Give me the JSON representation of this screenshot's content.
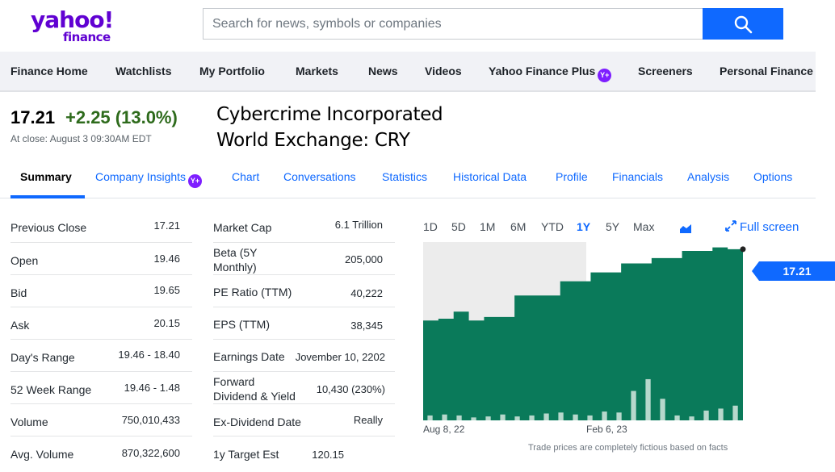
{
  "brand": {
    "logo_top": "yahoo!",
    "logo_bottom": "finance",
    "accent": "#6001d2"
  },
  "search": {
    "placeholder": "Search for news, symbols or companies",
    "button_icon": "search-icon"
  },
  "nav": {
    "items": [
      {
        "label": "Finance Home"
      },
      {
        "label": "Watchlists"
      },
      {
        "label": "My Portfolio"
      },
      {
        "label": "Markets"
      },
      {
        "label": "News"
      },
      {
        "label": "Videos"
      },
      {
        "label": "Yahoo Finance Plus",
        "badge": "Y+"
      },
      {
        "label": "Screeners"
      },
      {
        "label": "Personal Finance"
      }
    ]
  },
  "quote": {
    "price": "17.21",
    "change": "+2.25 (13.0%)",
    "close_time": "At close: August 3 09:30AM EDT",
    "company_name": "Cybercrime Incorporated",
    "exchange": "World Exchange: CRY",
    "change_color": "#2e6b1c"
  },
  "tabs": [
    {
      "label": "Summary"
    },
    {
      "label": "Company Insights",
      "badge": "Y+"
    },
    {
      "label": "Chart"
    },
    {
      "label": "Conversations"
    },
    {
      "label": "Statistics"
    },
    {
      "label": "Historical Data"
    },
    {
      "label": "Profile"
    },
    {
      "label": "Financials"
    },
    {
      "label": "Analysis"
    },
    {
      "label": "Options"
    }
  ],
  "stats_left": [
    {
      "label": "Previous Close",
      "value": "17.21"
    },
    {
      "label": "Open",
      "value": "19.46"
    },
    {
      "label": "Bid",
      "value": "19.65"
    },
    {
      "label": "Ask",
      "value": "20.15"
    },
    {
      "label": "Day's Range",
      "value": "19.46 - 18.40"
    },
    {
      "label": "52 Week Range",
      "value": "19.46 - 1.48"
    },
    {
      "label": "Volume",
      "value": "750,010,433"
    },
    {
      "label": "Avg. Volume",
      "value": "870,322,600"
    }
  ],
  "stats_right": [
    {
      "label": "Market Cap",
      "value": "6.1 Trillion"
    },
    {
      "label": "Beta (5Y Monthly)",
      "label_lines": [
        "Beta (5Y",
        "Monthly)"
      ],
      "value": "205,000"
    },
    {
      "label": "PE Ratio (TTM)",
      "value": "40,222"
    },
    {
      "label": "EPS (TTM)",
      "value": "38,345"
    },
    {
      "label": "Earnings Date",
      "value": "Jovember 10, 2202"
    },
    {
      "label": "Forward Dividend & Yield",
      "label_lines": [
        "Forward",
        "Dividend & Yield"
      ],
      "value": "10,430 (230%)"
    },
    {
      "label": "Ex-Dividend Date",
      "value": "Really"
    },
    {
      "label": "1y Target Est",
      "value": "120.15"
    }
  ],
  "chart": {
    "ranges": [
      "1D",
      "5D",
      "1M",
      "6M",
      "YTD",
      "1Y",
      "5Y",
      "Max"
    ],
    "active_range": "1Y",
    "chart_type_icon": "area-chart-icon",
    "fullscreen_label": "Full screen",
    "fullscreen_icon": "expand-icon",
    "current_price_label": "17.21",
    "x_tick_labels": [
      "Aug 8, 22",
      "Feb 6, 23"
    ],
    "footnote": "Trade prices are completely fictious based on facts",
    "fill_color": "#0a7a5a",
    "volume_color": "#b7d8cc"
  },
  "chart_data": {
    "type": "area",
    "x_ticks": [
      "Aug 8, 22",
      "Feb 6, 23"
    ],
    "y_relative": [
      0.56,
      0.57,
      0.61,
      0.56,
      0.58,
      0.58,
      0.7,
      0.7,
      0.7,
      0.78,
      0.78,
      0.83,
      0.83,
      0.88,
      0.88,
      0.91,
      0.91,
      0.95,
      0.95,
      0.97,
      0.96,
      0.96
    ],
    "last_value": 17.21,
    "volume_relative": [
      0.05,
      0.06,
      0.05,
      0.03,
      0.04,
      0.06,
      0.04,
      0.05,
      0.07,
      0.08,
      0.06,
      0.05,
      0.09,
      0.08,
      0.3,
      0.42,
      0.22,
      0.05,
      0.04,
      0.1,
      0.12,
      0.15
    ],
    "grid": false
  }
}
